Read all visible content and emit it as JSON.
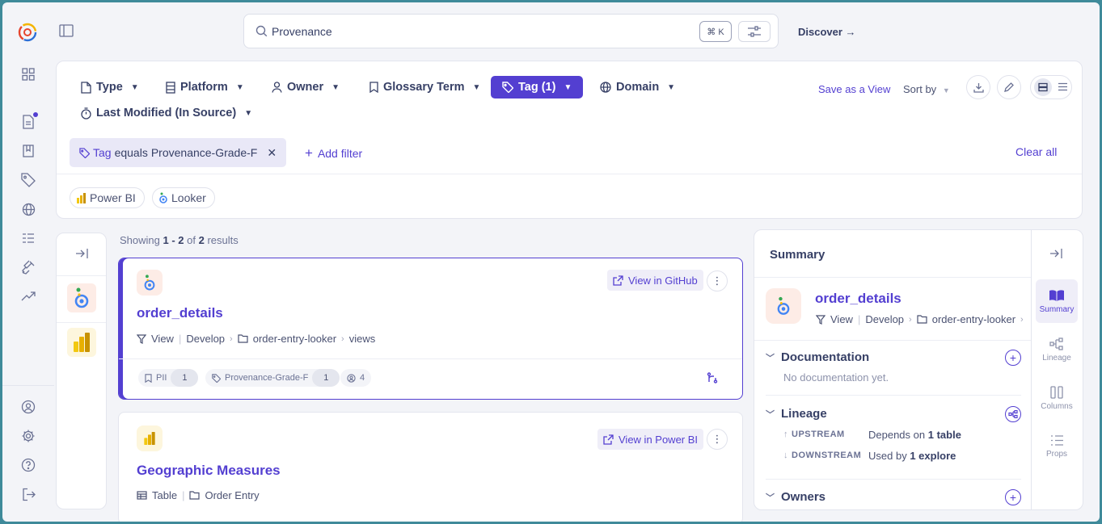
{
  "search": {
    "value": "Provenance",
    "shortcut": "⌘ K"
  },
  "header": {
    "discover": "Discover →"
  },
  "filters": {
    "type": "Type",
    "platform": "Platform",
    "owner": "Owner",
    "glossary": "Glossary Term",
    "tag": "Tag (1)",
    "domain": "Domain",
    "last_modified": "Last Modified (In Source)",
    "save_view": "Save as a View",
    "sort_by": "Sort by",
    "active_filter": {
      "field": "Tag",
      "op": "equals",
      "value": "Provenance-Grade-F"
    },
    "add_filter": "Add filter",
    "clear_all": "Clear all",
    "platforms": [
      "Power BI",
      "Looker"
    ]
  },
  "results": {
    "showing_prefix": "Showing",
    "range": "1 - 2",
    "of": "of",
    "total": "2",
    "suffix": "results",
    "items": [
      {
        "name": "order_details",
        "view_button": "View in GitHub",
        "type": "View",
        "path": [
          "Develop",
          "order-entry-looker",
          "views"
        ],
        "tags": [
          {
            "label": "PII",
            "count": "1"
          },
          {
            "label": "Provenance-Grade-F",
            "count": "1"
          },
          {
            "label": "4"
          }
        ]
      },
      {
        "name": "Geographic Measures",
        "view_button": "View in Power BI",
        "type": "Table",
        "path": [
          "Order Entry"
        ]
      }
    ]
  },
  "summary": {
    "title": "Summary",
    "name": "order_details",
    "type": "View",
    "path": [
      "Develop",
      "order-entry-looker"
    ],
    "documentation": "Documentation",
    "no_doc": "No documentation yet.",
    "lineage": "Lineage",
    "upstream": "UPSTREAM",
    "upstream_prefix": "Depends on",
    "upstream_count": "1 table",
    "downstream": "DOWNSTREAM",
    "downstream_prefix": "Used by",
    "downstream_count": "1 explore",
    "owners": "Owners"
  },
  "side_tabs": [
    "Summary",
    "Lineage",
    "Columns",
    "Props"
  ],
  "colors": {
    "accent": "#533fd1",
    "frame": "#3f8a9a"
  }
}
